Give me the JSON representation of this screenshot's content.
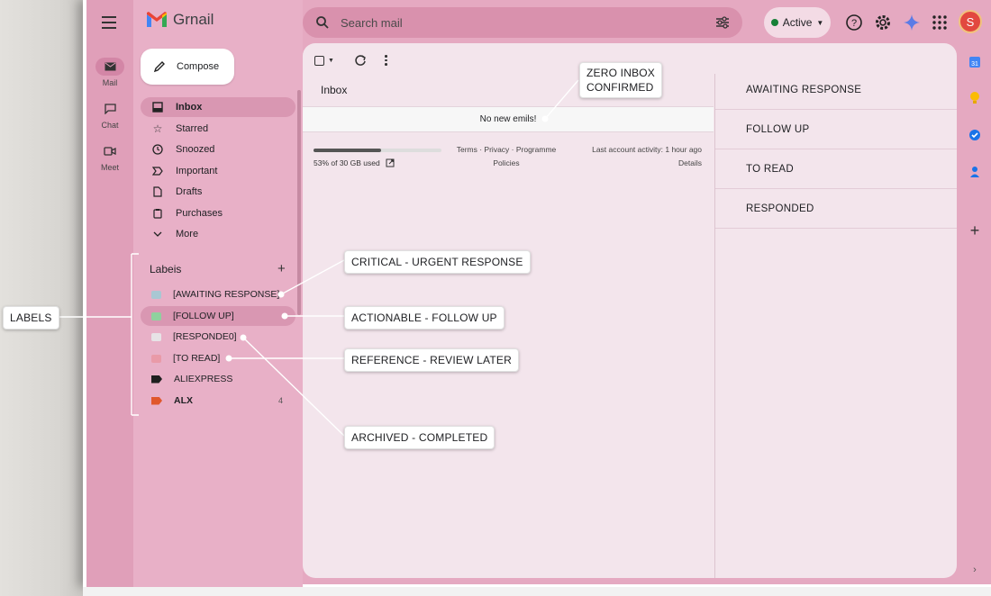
{
  "app": {
    "name": "Grnail"
  },
  "search": {
    "placeholder": "Search mail"
  },
  "status": {
    "label": "Active",
    "color": "#188038"
  },
  "avatar": {
    "initial": "S",
    "color": "#e2483f"
  },
  "rail": [
    {
      "label": "Mail",
      "icon": "mail-icon"
    },
    {
      "label": "Chat",
      "icon": "chat-icon"
    },
    {
      "label": "Meet",
      "icon": "meet-icon"
    }
  ],
  "compose": {
    "label": "Compose"
  },
  "nav": [
    {
      "label": "Inbox",
      "icon": "inbox-icon",
      "active": true
    },
    {
      "label": "Starred",
      "icon": "star-icon"
    },
    {
      "label": "Snoozed",
      "icon": "clock-icon"
    },
    {
      "label": "Important",
      "icon": "important-icon"
    },
    {
      "label": "Drafts",
      "icon": "draft-icon"
    },
    {
      "label": "Purchases",
      "icon": "purchases-icon"
    },
    {
      "label": "More",
      "icon": "chevron-down-icon"
    }
  ],
  "labels": {
    "heading": "Labeis",
    "items": [
      {
        "label": "[AWAITING RESPONSE]",
        "color": "#a9c7d3"
      },
      {
        "label": "[FOLLOW UP]",
        "color": "#8fd19e"
      },
      {
        "label": "[RESPONDE0]",
        "color": "#e7e3e6"
      },
      {
        "label": "[TO READ]",
        "color": "#e99aa8"
      },
      {
        "label": "ALIEXPRESS",
        "color": "#1f1f1f"
      },
      {
        "label": "ALX",
        "color": "#e0572b",
        "count": "4"
      }
    ]
  },
  "main": {
    "title": "Inbox",
    "empty_message": "No new emils!",
    "storage": {
      "used_fraction": 0.53,
      "text": "53% of 30 GB used"
    },
    "footer_links": [
      "Terms · Privacy · Programme",
      "Policies"
    ],
    "activity": [
      "Last account activity: 1 hour ago",
      "Details"
    ]
  },
  "right_panel": [
    "AWAITING RESPONSE",
    "FOLLOW UP",
    "TO READ",
    "RESPONDED"
  ],
  "annotations": {
    "zero_inbox": [
      "ZERO INBOX",
      "CONFIRMED"
    ],
    "critical": "CRITICAL - URGENT RESPONSE",
    "actionable": "ACTIONABLE - FOLLOW UP",
    "reference": "REFERENCE - REVIEW LATER",
    "archived": "ARCHIVED - COMPLETED",
    "labels_bracket": "LABELS"
  }
}
